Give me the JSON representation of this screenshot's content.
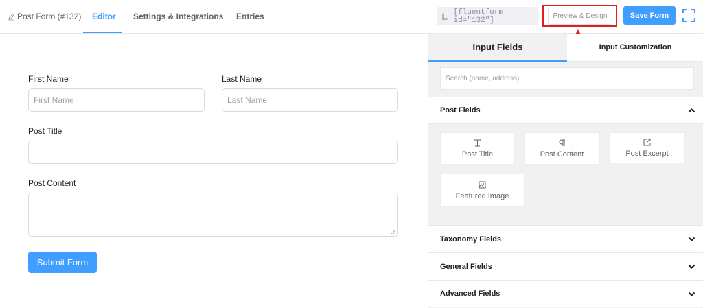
{
  "header": {
    "form_title": "Post Form (#132)",
    "tabs": [
      {
        "label": "Editor",
        "active": true
      },
      {
        "label": "Settings & Integrations",
        "active": false
      },
      {
        "label": "Entries",
        "active": false
      }
    ],
    "shortcode": "[fluentform id=\"132\"]",
    "preview_label": "Preview & Design",
    "save_label": "Save Form"
  },
  "form": {
    "first_name": {
      "label": "First Name",
      "placeholder": "First Name"
    },
    "last_name": {
      "label": "Last Name",
      "placeholder": "Last Name"
    },
    "post_title": {
      "label": "Post Title",
      "placeholder": ""
    },
    "post_content": {
      "label": "Post Content",
      "placeholder": ""
    },
    "submit_label": "Submit Form"
  },
  "sidebar": {
    "tabs": [
      {
        "label": "Input Fields",
        "active": true
      },
      {
        "label": "Input Customization",
        "active": false
      }
    ],
    "search_placeholder": "Search (name, address)...",
    "post_fields": {
      "title": "Post Fields",
      "items": [
        {
          "label": "Post Title",
          "icon": "text-cursor-icon"
        },
        {
          "label": "Post Content",
          "icon": "paragraph-icon"
        },
        {
          "label": "Post Excerpt",
          "icon": "excerpt-icon"
        },
        {
          "label": "Featured Image",
          "icon": "image-icon"
        }
      ]
    },
    "collapsed_sections": [
      "Taxonomy Fields",
      "General Fields",
      "Advanced Fields"
    ]
  },
  "colors": {
    "accent": "#409eff",
    "highlight": "#e0201b"
  }
}
